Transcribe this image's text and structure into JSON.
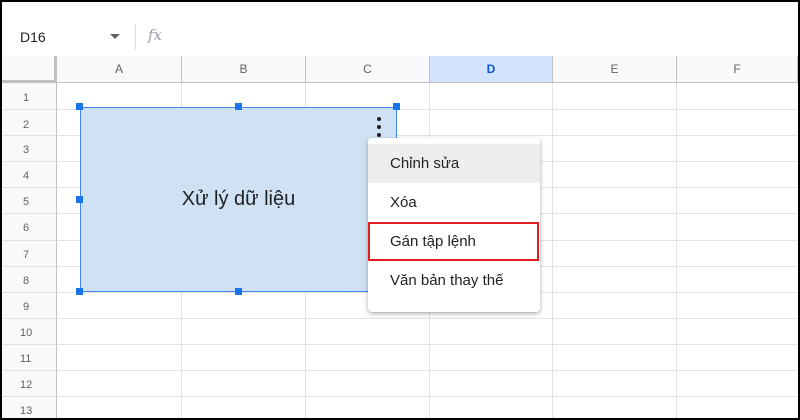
{
  "name_box": {
    "value": "D16"
  },
  "formula_bar": {
    "fx_label": "fx"
  },
  "columns": [
    "A",
    "B",
    "C",
    "D",
    "E",
    "F"
  ],
  "selected_column": "D",
  "rows": [
    "1",
    "2",
    "3",
    "4",
    "5",
    "6",
    "7",
    "8",
    "9",
    "10",
    "11",
    "12",
    "13"
  ],
  "drawing": {
    "text": "Xử lý dữ liệu"
  },
  "context_menu": {
    "items": [
      "Chỉnh sửa",
      "Xóa",
      "Gán tập lệnh",
      "Văn bản thay thế"
    ],
    "hovered_item": "Chỉnh sửa",
    "highlighted_item": "Gán tập lệnh"
  },
  "colors": {
    "selection_accent": "#1a73e8",
    "drawing_fill": "#cfe2f3",
    "highlight_border": "#e02020"
  }
}
